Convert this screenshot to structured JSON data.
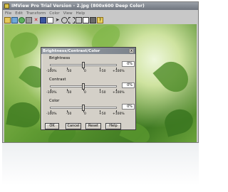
{
  "app": {
    "title": "IMView Pro Trial Version - 2.jpg (800x600 Deep Color)",
    "menu": [
      "File",
      "Edit",
      "Transform",
      "Color",
      "View",
      "Help"
    ]
  },
  "dialog": {
    "title": "Brightness/Contrast/Color",
    "close": "x",
    "scale": [
      "-100%",
      "-50",
      "0",
      "+50",
      "+100%"
    ],
    "controls": [
      {
        "label": "Brightness",
        "value": "0%",
        "level": 0
      },
      {
        "label": "Contrast",
        "value": "0%",
        "level": 0
      },
      {
        "label": "Color",
        "value": "0%",
        "level": 0
      }
    ],
    "buttons": {
      "ok": "OK",
      "cancel": "Cancel",
      "reset": "Reset",
      "help": "Help"
    }
  }
}
